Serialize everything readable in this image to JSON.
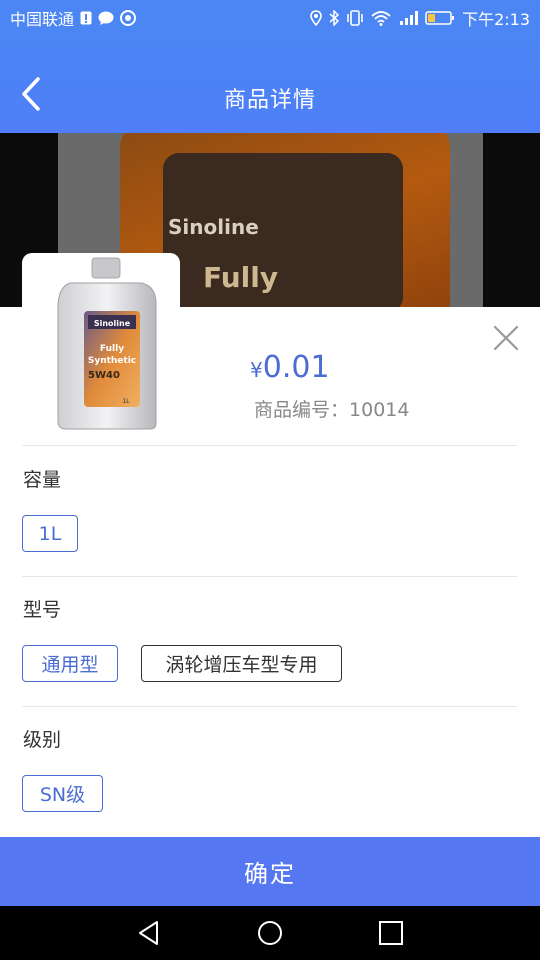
{
  "status_bar": {
    "carrier": "中国联通",
    "time": "下午2:13",
    "icons": [
      "alert-icon",
      "chat-icon",
      "camera-icon",
      "location-icon",
      "bluetooth-icon",
      "vibrate-icon",
      "wifi-icon",
      "signal-icon",
      "battery-icon"
    ]
  },
  "header": {
    "title": "商品详情",
    "back_icon": "chevron-left-icon"
  },
  "product_image_text": {
    "brand": "Sinoline",
    "fully": "Fully"
  },
  "product": {
    "currency": "¥",
    "price": "0.01",
    "code_label": "商品编号：",
    "code": "10014"
  },
  "specs": [
    {
      "label": "容量",
      "options": [
        {
          "text": "1L",
          "selected": true
        }
      ]
    },
    {
      "label": "型号",
      "options": [
        {
          "text": "通用型",
          "selected": true
        },
        {
          "text": "涡轮增压车型专用",
          "selected": false
        }
      ]
    },
    {
      "label": "级别",
      "options": [
        {
          "text": "SN级",
          "selected": true
        }
      ]
    }
  ],
  "confirm_label": "确定",
  "colors": {
    "accent": "#4b86f4",
    "selected_chip": "#4b6cd3",
    "confirm_bg": "#5677f2"
  },
  "nav": {
    "back": "triangle-back-icon",
    "home": "circle-home-icon",
    "recents": "square-recents-icon"
  }
}
